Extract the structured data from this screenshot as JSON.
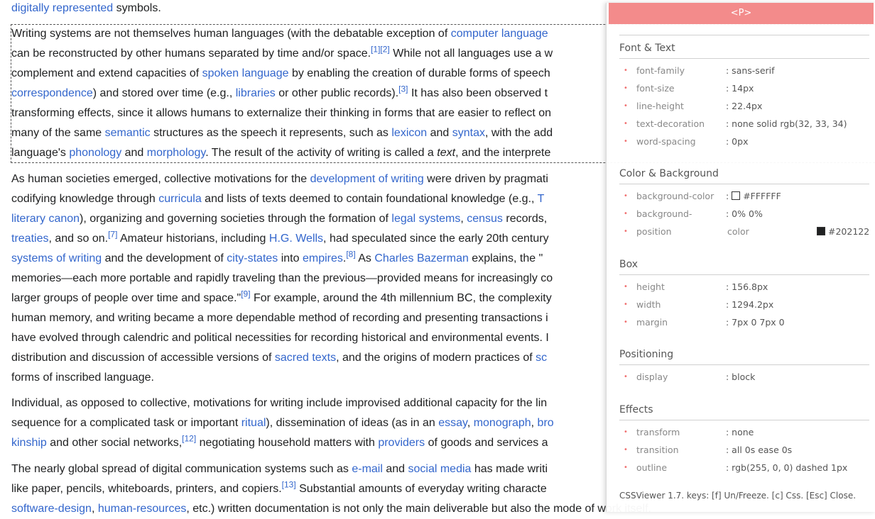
{
  "article": {
    "top_line": {
      "link": "digitally represented",
      "text": " symbols."
    },
    "p1": {
      "l1": {
        "t1": "Writing systems are not themselves human languages (with the debatable exception of ",
        "link1": "computer language"
      },
      "l2": {
        "t1": "can be reconstructed by other humans separated by time and/or space.",
        "sup1": "[1][2]",
        "t2": " While not all languages use a w"
      },
      "l3": {
        "t1": "complement and extend capacities of ",
        "link1": "spoken language",
        "t2": " by enabling the creation of durable forms of speech"
      },
      "l4": {
        "link1": "correspondence",
        "t1": ") and stored over time (e.g., ",
        "link2": "libraries",
        "t2": " or other public records).",
        "sup1": "[3]",
        "t3": " It has also been observed t"
      },
      "l5": {
        "t1": "transforming effects, since it allows humans to externalize their thinking in forms that are easier to reflect on"
      },
      "l6": {
        "t1": "many of the same ",
        "link1": "semantic",
        "t2": " structures as the speech it represents, such as ",
        "link2": "lexicon",
        "t3": " and ",
        "link3": "syntax",
        "t4": ", with the add"
      },
      "l7": {
        "t1": "language's ",
        "link1": "phonology",
        "t2": " and ",
        "link2": "morphology",
        "t3": ". The result of the activity of writing is called a ",
        "em1": "text",
        "t4": ", and the interprete"
      }
    },
    "p2": {
      "l1": {
        "t1": "As human societies emerged, collective motivations for the ",
        "link1": "development of writing",
        "t2": " were driven by pragmati"
      },
      "l2": {
        "t1": "codifying knowledge through ",
        "link1": "curricula",
        "t2": " and lists of texts deemed to contain foundational knowledge (e.g., ",
        "link2": "T"
      },
      "l3": {
        "link1": "literary canon",
        "t1": "), organizing and governing societies through the formation of ",
        "link2": "legal systems",
        "t2": ", ",
        "link3": "census",
        "t3": " records,"
      },
      "l4": {
        "link1": "treaties",
        "t1": ", and so on.",
        "sup1": "[7]",
        "t2": " Amateur historians, including ",
        "link2": "H.G. Wells",
        "t3": ", had speculated since the early 20th century"
      },
      "l5": {
        "link1": "systems of writing",
        "t1": " and the development of ",
        "link2": "city-states",
        "t2": " into ",
        "link3": "empires",
        "t3": ".",
        "sup1": "[8]",
        "t4": " As ",
        "link4": "Charles Bazerman",
        "t5": " explains, the \""
      },
      "l6": {
        "t1": "memories—each more portable and rapidly traveling than the previous—provided means for increasingly co"
      },
      "l7": {
        "t1": "larger groups of people over time and space.\"",
        "sup1": "[9]",
        "t2": " For example, around the 4th millennium BC, the complexity"
      },
      "l8": {
        "t1": "human memory, and writing became a more dependable method of recording and presenting transactions i"
      },
      "l9": {
        "t1": "have evolved through calendric and political necessities for recording historical and environmental events. I"
      },
      "l10": {
        "t1": "distribution and discussion of accessible versions of ",
        "link1": "sacred texts",
        "t2": ", and the origins of modern practices of ",
        "link2": "sc"
      },
      "l11": {
        "t1": "forms of inscribed language."
      }
    },
    "p3": {
      "l1": {
        "t1": "Individual, as opposed to collective, motivations for writing include improvised additional capacity for the lin"
      },
      "l2": {
        "t1": "sequence for a complicated task or important ",
        "link1": "ritual",
        "t2": "), dissemination of ideas (as in an ",
        "link2": "essay",
        "t3": ", ",
        "link3": "monograph",
        "t4": ", ",
        "link4": "bro"
      },
      "l3": {
        "link1": "kinship",
        "t1": " and other social networks,",
        "sup1": "[12]",
        "t2": " negotiating household matters with ",
        "link2": "providers",
        "t3": " of goods and services a"
      }
    },
    "p4": {
      "l1": {
        "t1": "The nearly global spread of digital communication systems such as ",
        "link1": "e-mail",
        "t2": " and ",
        "link2": "social media",
        "t3": " has made writi"
      },
      "l2": {
        "t1": "like paper, pencils, whiteboards, printers, and copiers.",
        "sup1": "[13]",
        "t2": " Substantial amounts of everyday writing characte"
      },
      "l3": {
        "link1": "software-design",
        "t1": ", ",
        "link2": "human-resources",
        "t2": ", etc.) written documentation is not only the main deliverable but also the mode of work itself."
      }
    }
  },
  "viewer": {
    "header": "<P>",
    "sections": {
      "font": {
        "title": "Font & Text",
        "rows": [
          {
            "name": "font-family",
            "val": ": sans-serif"
          },
          {
            "name": "font-size",
            "val": ": 14px"
          },
          {
            "name": "line-height",
            "val": ": 22.4px"
          },
          {
            "name": "text-decoration",
            "val": ": none solid rgb(32, 33, 34)"
          },
          {
            "name": "word-spacing",
            "val": ": 0px"
          }
        ]
      },
      "color": {
        "title": "Color & Background",
        "bg_color_name": "background-color",
        "bg_color_val": "#FFFFFF",
        "bg_pos_name1": "background-",
        "bg_pos_val": ": 0% 0%",
        "bg_pos_name2": "position",
        "color_name": "color",
        "color_val": "#202122"
      },
      "box": {
        "title": "Box",
        "rows": [
          {
            "name": "height",
            "val": ": 156.8px"
          },
          {
            "name": "width",
            "val": ": 1294.2px"
          },
          {
            "name": "margin",
            "val": ": 7px 0 7px 0"
          }
        ]
      },
      "positioning": {
        "title": "Positioning",
        "rows": [
          {
            "name": "display",
            "val": ": block"
          }
        ]
      },
      "effects": {
        "title": "Effects",
        "rows": [
          {
            "name": "transform",
            "val": ": none"
          },
          {
            "name": "transition",
            "val": ": all 0s ease 0s"
          },
          {
            "name": "outline",
            "val": ": rgb(255, 0, 0) dashed 1px"
          }
        ]
      }
    },
    "footer": "CSSViewer 1.7. keys: [f] Un/Freeze. [c] Css. [Esc] Close.",
    "colors": {
      "header_bg": "#f38b8b",
      "swatch_white": "#FFFFFF",
      "swatch_dark": "#202122"
    }
  }
}
